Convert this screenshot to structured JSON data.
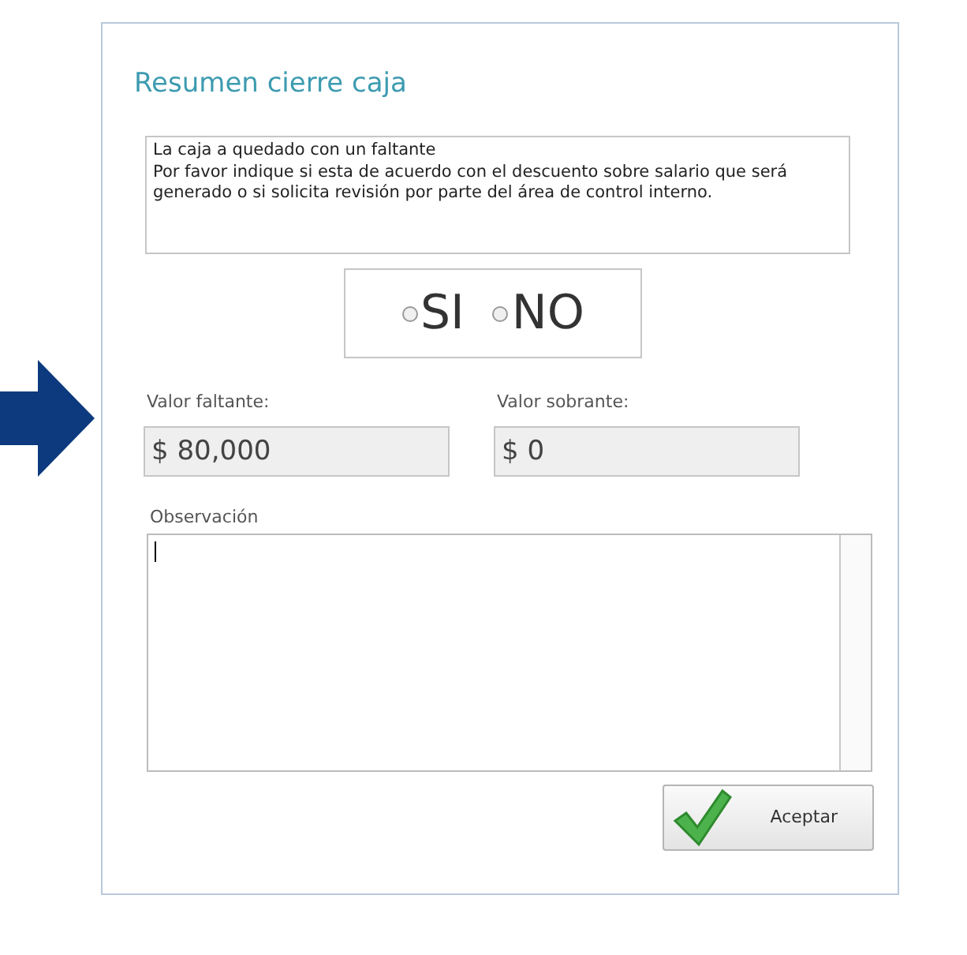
{
  "dialog": {
    "title": "Resumen cierre caja"
  },
  "message": [
    "La caja a quedado con un faltante",
    "Por favor indique si esta de acuerdo con el descuento sobre salario que será generado o si solicita revisión por parte del área de control interno."
  ],
  "options": [
    {
      "label": "SI",
      "selected": false
    },
    {
      "label": "NO",
      "selected": false
    }
  ],
  "fields": [
    {
      "label": "Valor faltante:",
      "value": "$ 80,000"
    },
    {
      "label": "Valor sobrante:",
      "value": "$ 0"
    }
  ],
  "observation": {
    "label": "Observación"
  },
  "button": {
    "label": "Aceptar"
  }
}
